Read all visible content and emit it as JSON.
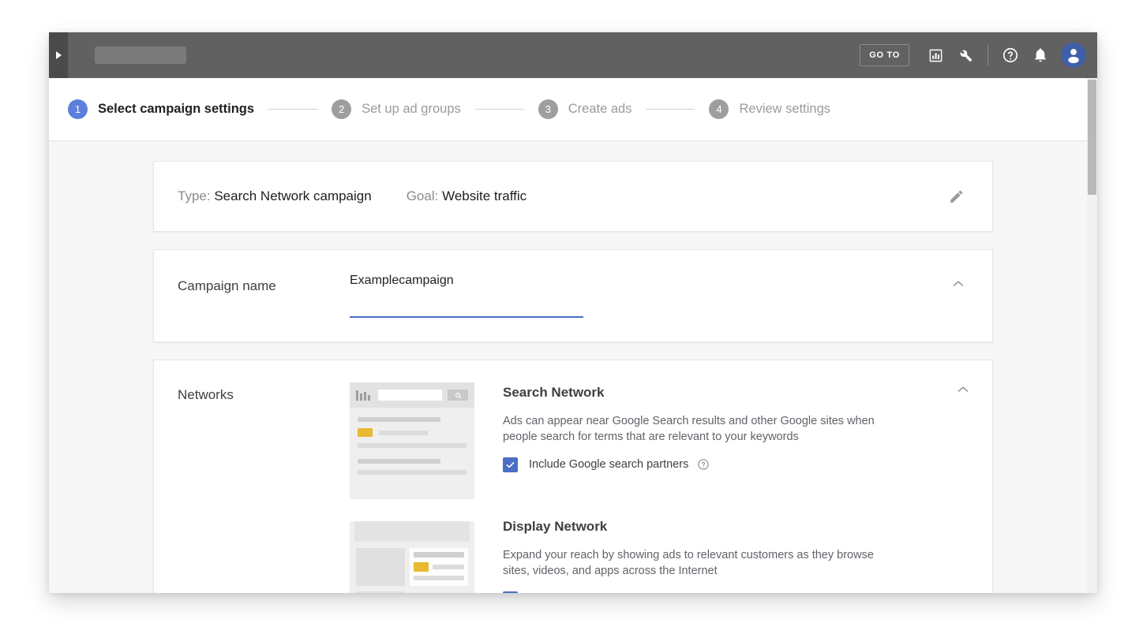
{
  "header": {
    "search_placeholder": "",
    "goto_label": "GO TO",
    "icons": {
      "expand_rail": "play-arrow-icon",
      "reports": "bar-chart-icon",
      "tools": "wrench-icon",
      "help": "help-circle-icon",
      "notifications": "bell-icon",
      "account": "avatar-icon"
    }
  },
  "stepper": {
    "steps": [
      {
        "num": "1",
        "label": "Select campaign settings",
        "active": true
      },
      {
        "num": "2",
        "label": "Set up ad groups",
        "active": false
      },
      {
        "num": "3",
        "label": "Create ads",
        "active": false
      },
      {
        "num": "4",
        "label": "Review settings",
        "active": false
      }
    ]
  },
  "summary_card": {
    "type_key": "Type:",
    "type_value": "Search Network campaign",
    "goal_key": "Goal:",
    "goal_value": "Website traffic",
    "edit_icon": "pencil-icon"
  },
  "campaign_name_card": {
    "label": "Campaign name",
    "value": "Examplecampaign",
    "placeholder": "Campaign name",
    "collapse_icon": "chevron-up-icon"
  },
  "networks_card": {
    "label": "Networks",
    "collapse_icon": "chevron-up-icon",
    "search_network": {
      "title": "Search Network",
      "description": "Ads can appear near Google Search results and other Google sites when people search for terms that are relevant to your keywords",
      "checkbox_label": "Include Google search partners",
      "checked": true,
      "help_icon": "help-circle-icon"
    },
    "display_network": {
      "title": "Display Network",
      "description": "Expand your reach by showing ads to relevant customers as they browse sites, videos, and apps across the Internet",
      "checked": true,
      "help_icon": "help-circle-icon"
    }
  },
  "colors": {
    "accent_blue": "#4a6fc4",
    "step_active": "#5b7fda",
    "header_gray": "#616161",
    "ad_badge_yellow": "#e8b931"
  }
}
